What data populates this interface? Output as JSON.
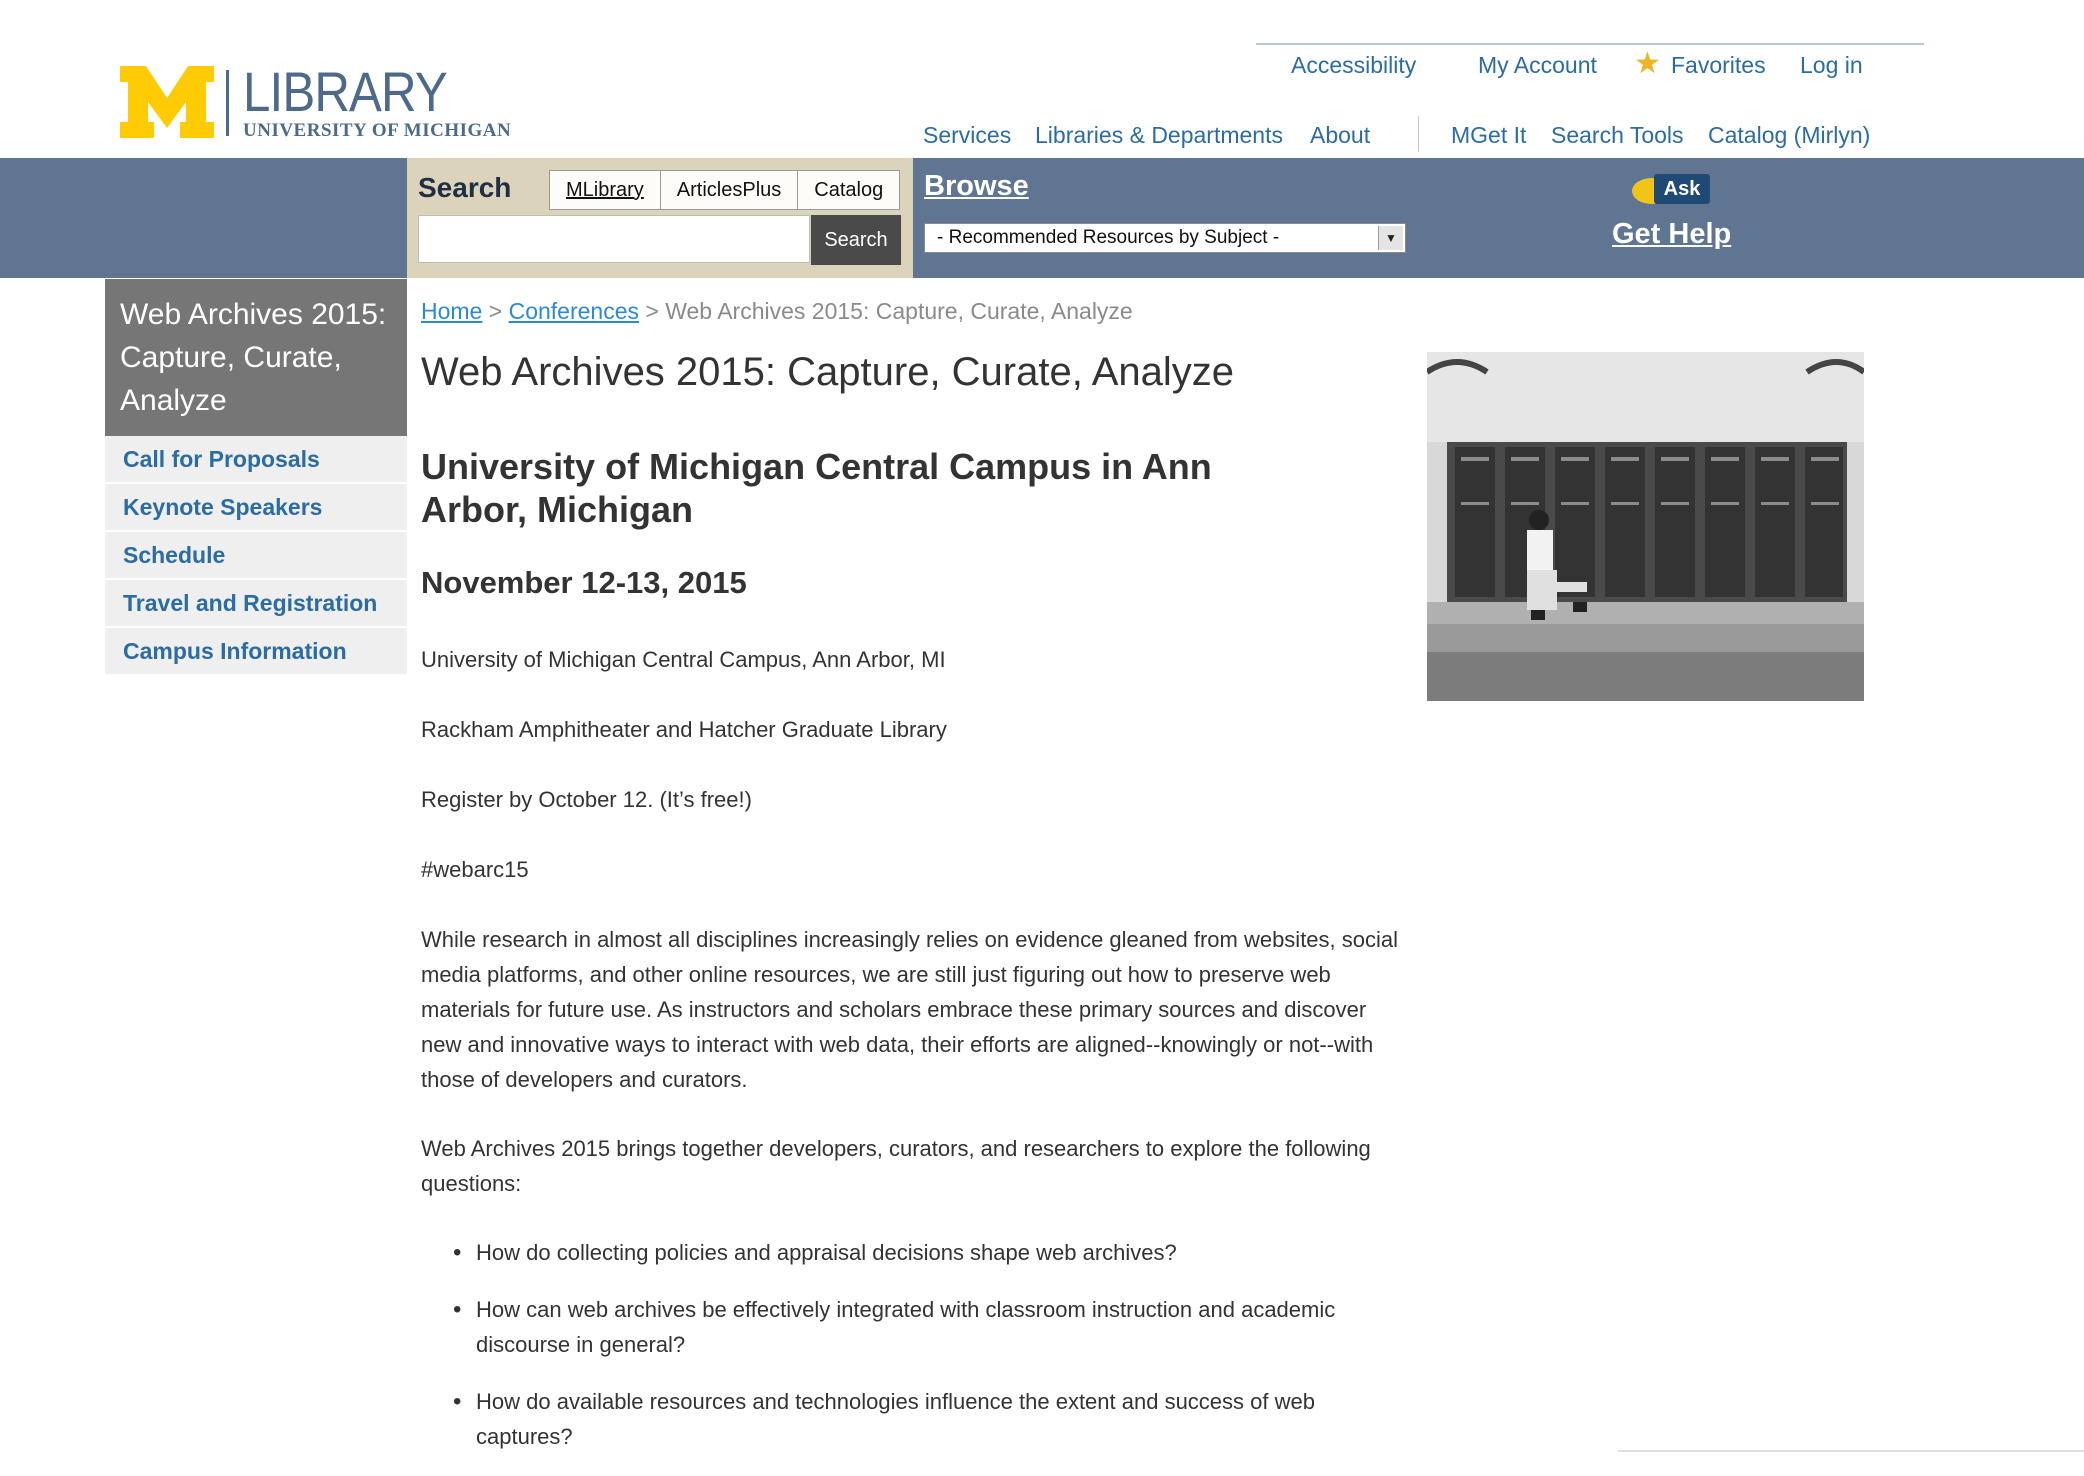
{
  "logo": {
    "library": "LIBRARY",
    "university": "UNIVERSITY OF MICHIGAN"
  },
  "utility_nav": {
    "accessibility": "Accessibility",
    "my_account": "My Account",
    "favorites": "Favorites",
    "login": "Log in"
  },
  "main_nav": {
    "services": "Services",
    "libraries": "Libraries & Departments",
    "about": "About",
    "mget": "MGet It",
    "search_tools": "Search Tools",
    "catalog": "Catalog (Mirlyn)"
  },
  "search": {
    "label": "Search",
    "tabs": [
      "MLibrary",
      "ArticlesPlus",
      "Catalog"
    ],
    "input_value": "",
    "button": "Search"
  },
  "browse": {
    "label": "Browse",
    "selected": "- Recommended Resources by Subject -"
  },
  "help": {
    "ask": "Ask",
    "get_help": "Get Help"
  },
  "sidebar": {
    "title": "Web Archives 2015: Capture, Curate, Analyze",
    "items": [
      "Call for Proposals",
      "Keynote Speakers",
      "Schedule",
      "Travel and Registration",
      "Campus Information"
    ]
  },
  "breadcrumb": {
    "home": "Home",
    "sep": ">",
    "conferences": "Conferences",
    "current": "Web Archives 2015: Capture, Curate, Analyze"
  },
  "content": {
    "title": "Web Archives 2015: Capture, Curate, Analyze",
    "venue": "University of Michigan Central Campus in Ann Arbor, Michigan",
    "dates": "November 12-13, 2015",
    "p_location": "University of Michigan Central Campus, Ann Arbor, MI",
    "p_rooms": "Rackham Amphitheater and Hatcher Graduate Library",
    "p_register": "Register by October 12. (It’s free!)",
    "p_hashtag": "#webarc15",
    "p_intro": "While research in almost all disciplines increasingly relies on evidence gleaned from websites, social media platforms, and other online resources, we are still just figuring out how to preserve web materials for future use. As instructors and scholars embrace these primary sources and discover new and innovative ways to interact with web data, their efforts are aligned--knowingly or not--with those of developers and curators.",
    "p_questions": "Web Archives 2015 brings together developers, curators, and researchers to explore the following questions:",
    "questions": [
      "How do collecting policies and appraisal decisions shape web archives?",
      "How can web archives be effectively integrated with classroom instruction and academic discourse in general?",
      "How do available resources and technologies influence the extent and success of web captures?"
    ]
  },
  "colors": {
    "brand_blue": "#607591",
    "link": "#2b6ca3",
    "maize": "#ffcb05",
    "search_bg": "#dcd3bb",
    "sidebar_title_bg": "#767676"
  }
}
